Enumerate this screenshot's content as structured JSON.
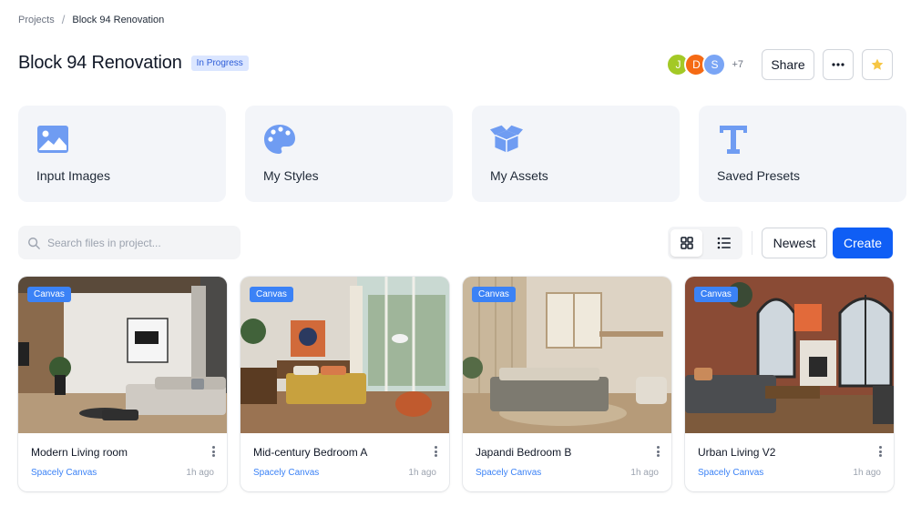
{
  "breadcrumb": {
    "parent": "Projects",
    "separator": "/",
    "current": "Block 94 Renovation"
  },
  "header": {
    "title": "Block 94 Renovation",
    "status": "In Progress",
    "avatars": [
      {
        "initial": "J",
        "color": "#a3c926"
      },
      {
        "initial": "D",
        "color": "#f56a14"
      },
      {
        "initial": "S",
        "color": "#7aa5f5"
      }
    ],
    "more_members": "+7",
    "share_label": "Share",
    "more_icon": "ellipsis-icon",
    "star_icon": "star-icon"
  },
  "quick_cards": [
    {
      "label": "Input Images",
      "icon": "image-icon"
    },
    {
      "label": "My Styles",
      "icon": "palette-icon"
    },
    {
      "label": "My Assets",
      "icon": "box-icon"
    },
    {
      "label": "Saved Presets",
      "icon": "text-icon"
    }
  ],
  "toolbar": {
    "search_placeholder": "Search files in project...",
    "view_modes": [
      "grid",
      "list"
    ],
    "active_view": "grid",
    "sort_label": "Newest",
    "create_label": "Create"
  },
  "files": [
    {
      "type": "Canvas",
      "name": "Modern Living room",
      "source": "Spacely Canvas",
      "time": "1h ago"
    },
    {
      "type": "Canvas",
      "name": "Mid-century Bedroom A",
      "source": "Spacely Canvas",
      "time": "1h ago"
    },
    {
      "type": "Canvas",
      "name": "Japandi Bedroom B",
      "source": "Spacely Canvas",
      "time": "1h ago"
    },
    {
      "type": "Canvas",
      "name": "Urban Living V2",
      "source": "Spacely Canvas",
      "time": "1h ago"
    }
  ],
  "colors": {
    "accent": "#0f5ef5",
    "icon": "#6f9cf2",
    "badge": "#3b82f6",
    "card_bg": "#f3f5f9"
  }
}
